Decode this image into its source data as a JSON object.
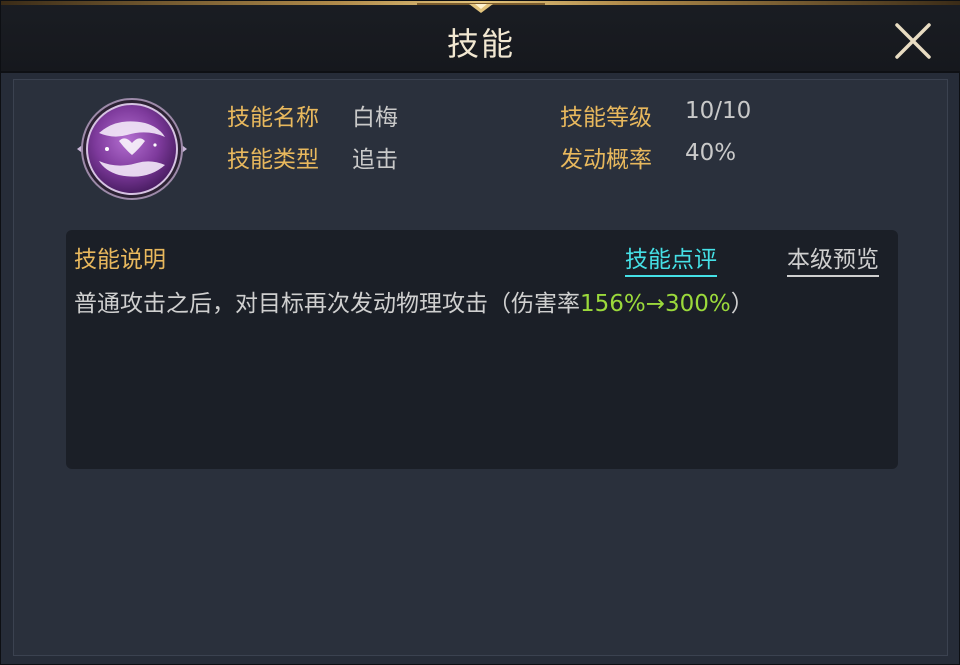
{
  "dialog": {
    "title": "技能",
    "close_icon": "close-icon"
  },
  "skill": {
    "icon": "skill-emblem-icon",
    "name_label": "技能名称",
    "name_value": "白梅",
    "type_label": "技能类型",
    "type_value": "追击",
    "level_label": "技能等级",
    "level_value": "10/10",
    "chance_label": "发动概率",
    "chance_value": "40%"
  },
  "description": {
    "title": "技能说明",
    "review_link": "技能点评",
    "preview_link": "本级预览",
    "text_prefix": "普通攻击之后，对目标再次发动物理攻击（伤害率",
    "text_highlight": "156%→300%",
    "text_suffix": "）"
  },
  "colors": {
    "label_gold": "#e8b85d",
    "value_grey": "#c9c9c9",
    "link_cyan": "#45e0e6",
    "highlight_green": "#9bd93b",
    "icon_purple": "#8b3fa6"
  }
}
